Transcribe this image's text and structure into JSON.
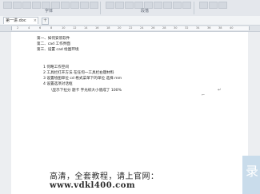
{
  "ribbon": {
    "group_font": "字体",
    "group_paragraph": "段落"
  },
  "tabs": [
    {
      "label": "第一讲.doc"
    }
  ],
  "tab_close": "×",
  "tab_add": "+",
  "ruler_numbers": [
    "2",
    "4",
    "6",
    "8",
    "10",
    "12",
    "14",
    "16",
    "18",
    "20",
    "22",
    "24",
    "26",
    "28",
    "30",
    "32",
    "34",
    "36",
    "38",
    "40"
  ],
  "document": {
    "toc": [
      "第一、如何安装软件",
      "第二、cad 工作界面",
      "第三、设置 cad 绘图环境"
    ],
    "steps": [
      "1 何略工作空间",
      "2 工具栏打开方法   在任何一工具栏右键材料",
      "3 设置绘图单位   cd  格式菜单下的单位   选择 mm",
      "4 设置选项对话框",
      "  \\显示下拉分 题卡 字光标大小值成了 100%"
    ],
    "paragraph_mark": "↵",
    "cursor_mark": "⌐"
  },
  "banner": {
    "line1": "高清，全套教程，请上官网：",
    "line2": "www.vdkl400.com"
  },
  "sidebar": {
    "glyph": "录"
  }
}
